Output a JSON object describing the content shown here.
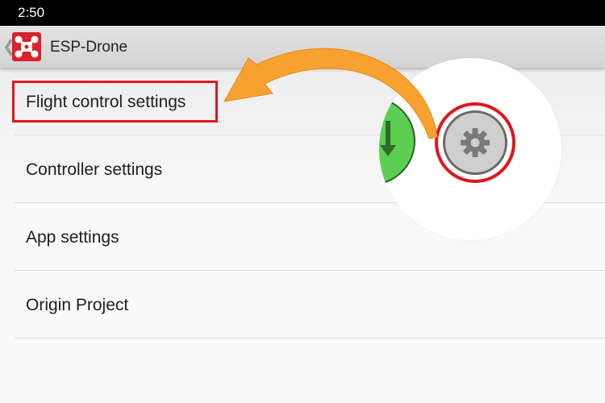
{
  "status_bar": {
    "time": "2:50"
  },
  "action_bar": {
    "title": "ESP-Drone",
    "app_icon": "drone-icon",
    "back_icon": "chevron-left-icon"
  },
  "menu": {
    "items": [
      {
        "label": "Flight control settings"
      },
      {
        "label": "Controller settings"
      },
      {
        "label": "App settings"
      },
      {
        "label": "Origin Project"
      }
    ]
  },
  "zoom_callout": {
    "buttons": [
      {
        "icon": "download-arrow-icon",
        "color": "#5ccf52"
      },
      {
        "icon": "gear-icon",
        "color": "#cfcfcf"
      }
    ],
    "highlight_color": "#e0161d",
    "arrow_color": "#f7a130"
  }
}
